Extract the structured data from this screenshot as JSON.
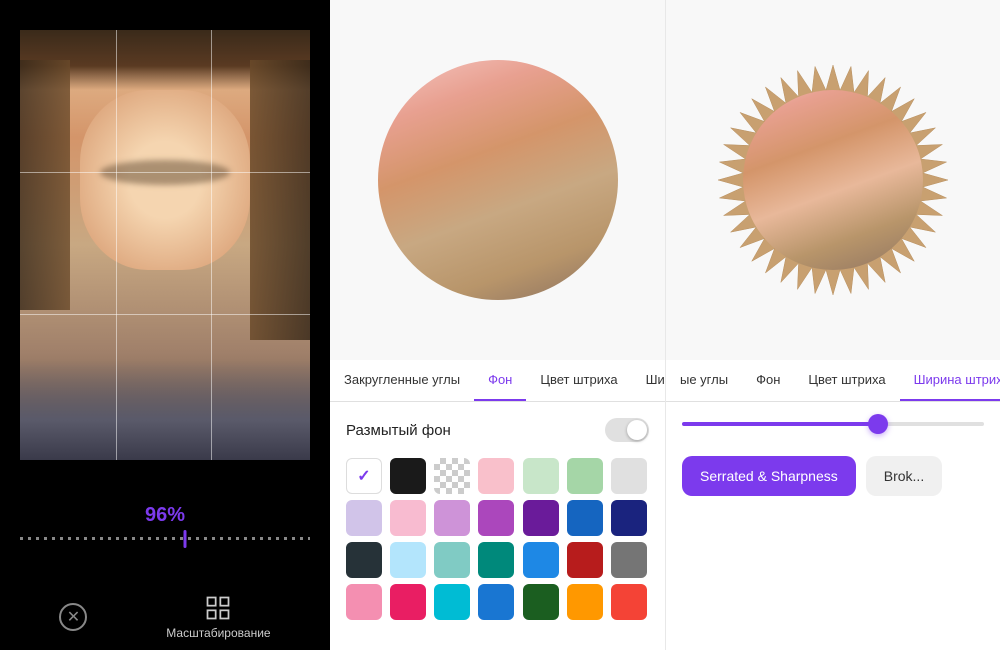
{
  "left": {
    "percentage": "96%",
    "bottom_bar": {
      "cancel_label": "✕",
      "scale_label": "Масштабирование"
    }
  },
  "middle": {
    "tabs": [
      {
        "id": "rounded",
        "label": "Закругленные углы",
        "active": false
      },
      {
        "id": "background",
        "label": "Фон",
        "active": true
      },
      {
        "id": "stroke_color",
        "label": "Цвет штриха",
        "active": false
      },
      {
        "id": "stroke_width",
        "label": "Шир...",
        "active": false
      }
    ],
    "blur_toggle": {
      "label": "Размытый фон",
      "enabled": false
    },
    "colors": [
      {
        "id": "white-check",
        "hex": "#ffffff",
        "checked": true
      },
      {
        "id": "black",
        "hex": "#1a1a1a"
      },
      {
        "id": "transparent",
        "hex": "transparent"
      },
      {
        "id": "pink-light",
        "hex": "#f9c0cb"
      },
      {
        "id": "green-light",
        "hex": "#c8e6c9"
      },
      {
        "id": "green-mid",
        "hex": "#a5d6a7"
      },
      {
        "id": "gray-light",
        "hex": "#e0e0e0"
      },
      {
        "id": "lavender",
        "hex": "#d1c4e9"
      },
      {
        "id": "pink-pale",
        "hex": "#f8bbd0"
      },
      {
        "id": "purple-light",
        "hex": "#ce93d8"
      },
      {
        "id": "purple-mid",
        "hex": "#ab47bc"
      },
      {
        "id": "purple-dark",
        "hex": "#6a1b9a"
      },
      {
        "id": "blue-mid",
        "hex": "#1565c0"
      },
      {
        "id": "navy",
        "hex": "#0d2b6e"
      },
      {
        "id": "navy-dark",
        "hex": "#263238"
      },
      {
        "id": "blue-sky",
        "hex": "#b3e5fc"
      },
      {
        "id": "teal-light",
        "hex": "#80cbc4"
      },
      {
        "id": "teal-mid",
        "hex": "#00897b"
      },
      {
        "id": "blue-bright",
        "hex": "#1e88e5"
      },
      {
        "id": "red-dark",
        "hex": "#b71c1c"
      },
      {
        "id": "gray-mid",
        "hex": "#757575"
      },
      {
        "id": "pink-hot",
        "hex": "#f8bbd0"
      },
      {
        "id": "magenta",
        "hex": "#e91e63"
      },
      {
        "id": "cyan",
        "hex": "#00bcd4"
      },
      {
        "id": "blue-royal",
        "hex": "#1976d2"
      },
      {
        "id": "green-dark",
        "hex": "#1b5e20"
      },
      {
        "id": "orange",
        "hex": "#ff9800"
      },
      {
        "id": "red-bright",
        "hex": "#f44336"
      }
    ]
  },
  "right": {
    "tabs": [
      {
        "id": "rounded",
        "label": "ые углы",
        "active": false
      },
      {
        "id": "background",
        "label": "Фон",
        "active": false
      },
      {
        "id": "stroke_color",
        "label": "Цвет штриха",
        "active": false
      },
      {
        "id": "stroke_width",
        "label": "Ширина штриха",
        "active": true
      }
    ],
    "slider_value": 65,
    "shape_buttons": [
      {
        "id": "serrated",
        "label": "Serrated & Sharpness",
        "active": true
      },
      {
        "id": "broken",
        "label": "Brok...",
        "active": false
      }
    ]
  }
}
